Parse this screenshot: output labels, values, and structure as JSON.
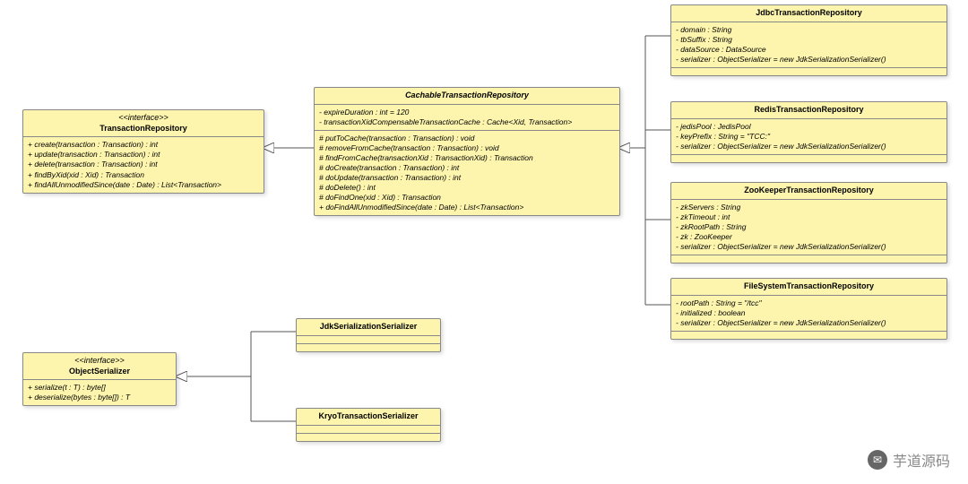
{
  "classes": {
    "transactionRepository": {
      "stereotype": "<<interface>>",
      "name": "TransactionRepository",
      "methods": [
        "+ create(transaction : Transaction) : int",
        "+ update(transaction : Transaction) : int",
        "+ delete(transaction : Transaction) : int",
        "+ findByXid(xid : Xid) : Transaction",
        "+ findAllUnmodifiedSince(date : Date) : List<Transaction>"
      ]
    },
    "cachableTransactionRepository": {
      "name": "CachableTransactionRepository",
      "fields": [
        "- expireDuration : int = 120",
        "- transactionXidCompensableTransactionCache : Cache<Xid, Transaction>"
      ],
      "methods": [
        "# putToCache(transaction : Transaction) : void",
        "# removeFromCache(transaction : Transaction) : void",
        "# findFromCache(transactionXid : TransactionXid) : Transaction",
        "# doCreate(transaction : Transaction) : int",
        "# doUpdate(transaction : Transaction) : int",
        "# doDelete() : int",
        "# doFindOne(xid : Xid) : Transaction",
        "+ doFindAllUnmodifiedSince(date : Date) : List<Transaction>"
      ]
    },
    "jdbcTransactionRepository": {
      "name": "JdbcTransactionRepository",
      "fields": [
        "- domain : String",
        "- tbSuffix : String",
        "- dataSource : DataSource",
        "- serializer : ObjectSerializer = new JdkSerializationSerializer()"
      ]
    },
    "redisTransactionRepository": {
      "name": "RedisTransactionRepository",
      "fields": [
        "- jedisPool : JedisPool",
        "- keyPrefix : String = \"TCC:\"",
        "- serializer : ObjectSerializer = new JdkSerializationSerializer()"
      ]
    },
    "zooKeeperTransactionRepository": {
      "name": "ZooKeeperTransactionRepository",
      "fields": [
        "- zkServers : String",
        "- zkTimeout : int",
        "- zkRootPath : String",
        "- zk : ZooKeeper",
        "- serializer : ObjectSerializer = new JdkSerializationSerializer()"
      ]
    },
    "fileSystemTransactionRepository": {
      "name": "FileSystemTransactionRepository",
      "fields": [
        "- rootPath : String = \"/tcc\"",
        "- initialized : boolean",
        "- serializer : ObjectSerializer = new JdkSerializationSerializer()"
      ]
    },
    "objectSerializer": {
      "stereotype": "<<interface>>",
      "name": "ObjectSerializer",
      "methods": [
        "+ serialize(t : T) : byte[]",
        "+ deserialize(bytes : byte[]) : T"
      ]
    },
    "jdkSerializationSerializer": {
      "name": "JdkSerializationSerializer"
    },
    "kryoTransactionSerializer": {
      "name": "KryoTransactionSerializer"
    }
  },
  "watermark": "芋道源码"
}
